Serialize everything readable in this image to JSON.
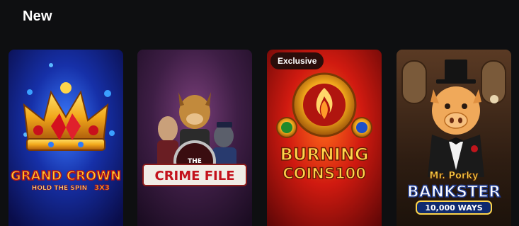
{
  "section": {
    "title": "New"
  },
  "games": [
    {
      "title_line1": "GRAND CROWN",
      "title_line2": "HOLD THE SPIN",
      "title_line3": "3X3"
    },
    {
      "title_line1": "THE",
      "title_line2": "CRIME FILE"
    },
    {
      "badge": "Exclusive",
      "title_line1": "BURNING",
      "title_line2": "COINS100"
    },
    {
      "title_line1": "Mr. Porky",
      "title_line2": "BANKSTER",
      "title_line3": "10,000 WAYS"
    }
  ],
  "colors": {
    "background": "#0e0f11",
    "badge_bg": "#2a0d0a"
  }
}
